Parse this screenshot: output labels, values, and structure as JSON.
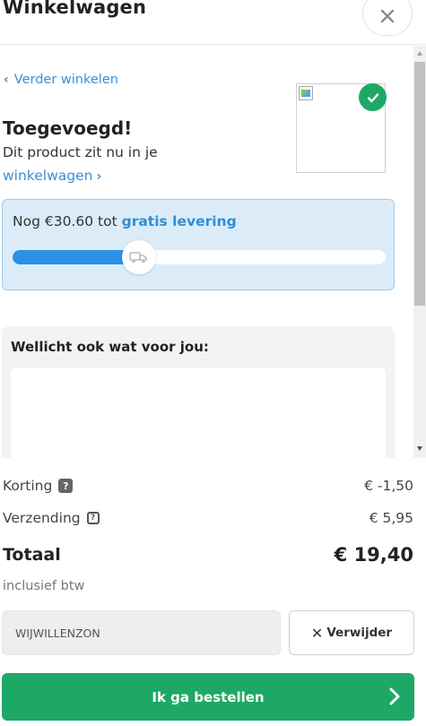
{
  "header": {
    "title": "Winkelwagen",
    "close_icon": "close-icon"
  },
  "added": {
    "continue_label": "Verder winkelen",
    "title": "Toegevoegd!",
    "text": "Dit product zit nu in je",
    "cart_link": "winkelwagen"
  },
  "shipping": {
    "prefix": "Nog €30.60 tot",
    "highlight": "gratis levering",
    "progress_fraction": 0.34,
    "icon": "delivery-truck-icon"
  },
  "suggestions": {
    "title": "Wellicht ook wat voor jou:"
  },
  "summary": {
    "discount_label": "Korting",
    "discount_value": "€ -1,50",
    "shipping_label": "Verzending",
    "shipping_value": "€ 5,95",
    "total_label": "Totaal",
    "total_value": "€ 19,40",
    "vat_note": "inclusief btw"
  },
  "coupon": {
    "code": "WIJWILLENZON",
    "remove_label": "Verwijder"
  },
  "checkout": {
    "order_label": "Ik ga bestellen"
  },
  "colors": {
    "accent_green": "#1ea866",
    "link_blue": "#3a8fd6",
    "progress_blue": "#2b91e4",
    "shipping_bg": "#dbecf8"
  }
}
